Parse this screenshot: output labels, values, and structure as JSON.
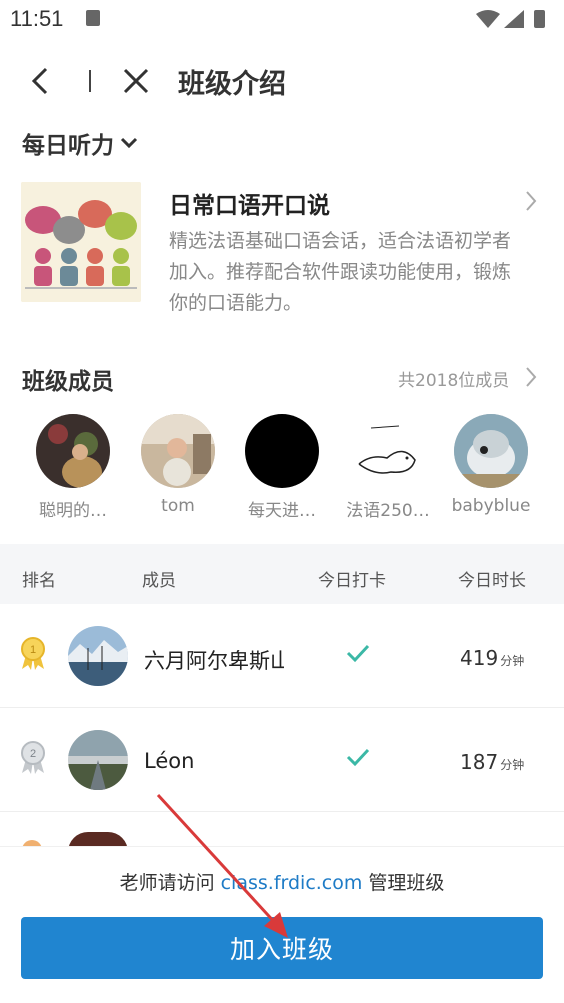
{
  "status": {
    "time": "11:51"
  },
  "nav": {
    "title": "班级介绍"
  },
  "subtitle": "每日听力",
  "intro": {
    "title": "日常口语开口说",
    "desc": "精选法语基础口语会话，适合法语初学者加入。推荐配合软件跟读功能使用，锻炼你的口语能力。"
  },
  "members": {
    "title": "班级成员",
    "count": "共2018位成员",
    "list": [
      {
        "name": "聪明的…"
      },
      {
        "name": "tom"
      },
      {
        "name": "每天进…"
      },
      {
        "name": "法语250…"
      },
      {
        "name": "babyblue"
      }
    ]
  },
  "table": {
    "headers": {
      "rank": "排名",
      "member": "成员",
      "checkin": "今日打卡",
      "duration": "今日时长"
    },
    "rows": [
      {
        "rank": "1",
        "name": "六月阿尔卑斯山",
        "minutes": "419",
        "unit": "分钟",
        "checked": true
      },
      {
        "rank": "2",
        "name": "Léon",
        "minutes": "187",
        "unit": "分钟",
        "checked": true
      }
    ]
  },
  "footer": {
    "note_prefix": "老师请访问 ",
    "note_link": "class.frdic.com",
    "note_suffix": " 管理班级",
    "join_label": "加入班级"
  },
  "colors": {
    "accent": "#2085d0",
    "check": "#3bb8a6",
    "link": "#1e7bc6"
  }
}
